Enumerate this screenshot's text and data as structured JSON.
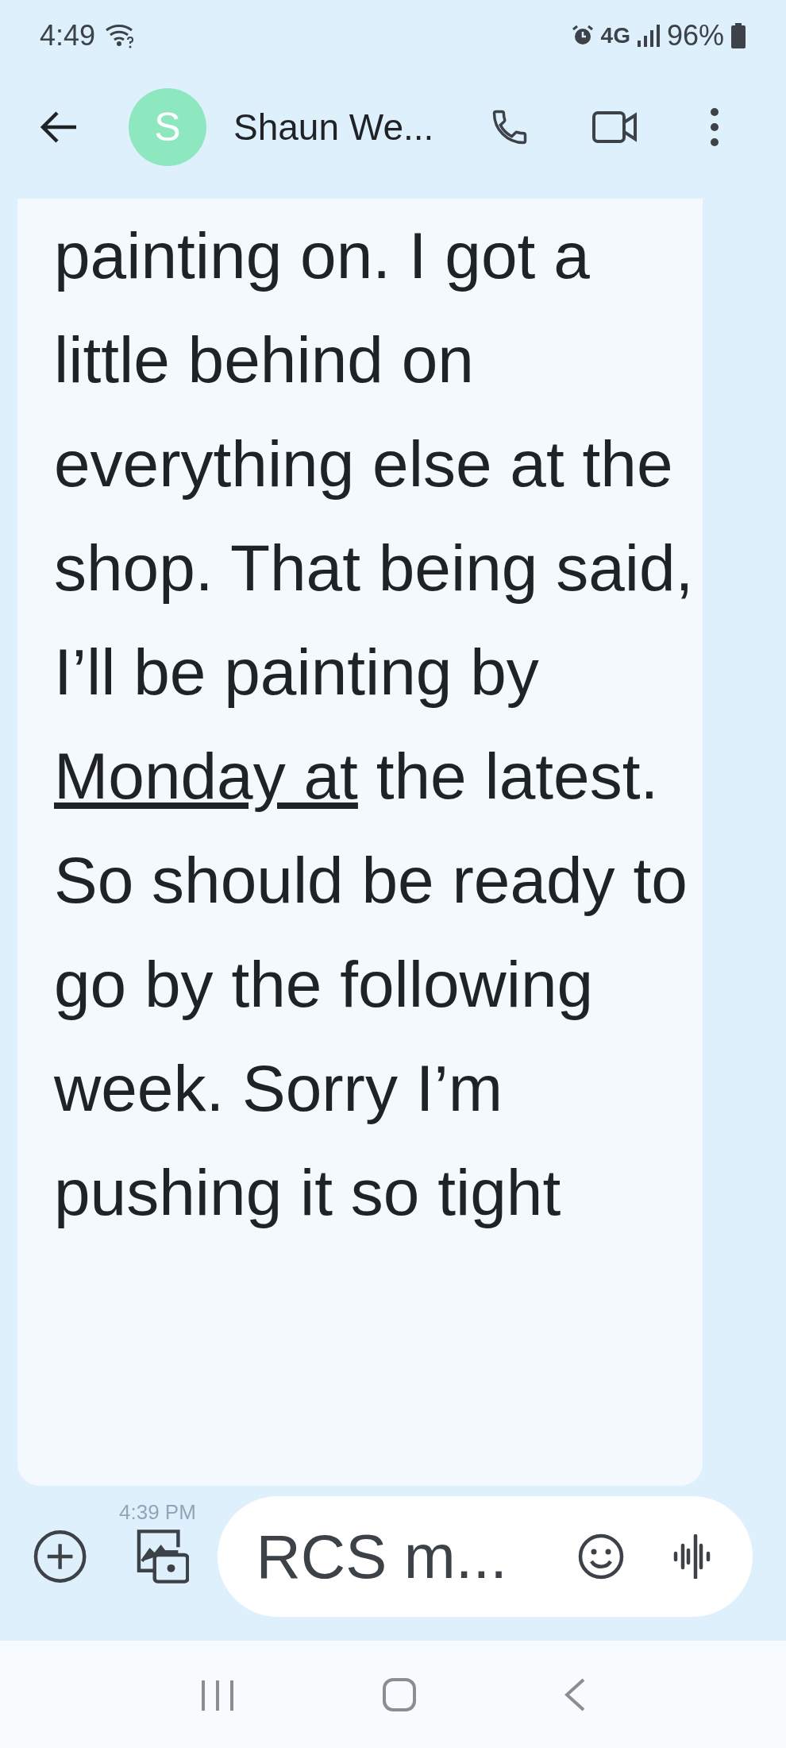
{
  "status_bar": {
    "time": "4:49",
    "network": "4G",
    "battery": "96%"
  },
  "header": {
    "avatar_letter": "S",
    "contact_name": "Shaun We..."
  },
  "message": {
    "text_before": "painting on. I got a little behind on everything else at the shop. That being said, I’ll be painting by",
    "link": "Monday at",
    "text_after": "the latest. So should be ready to go by the following week. Sorry I’m pushing it so tight",
    "time": "4:39 PM"
  },
  "composer": {
    "placeholder": "RCS m..."
  }
}
